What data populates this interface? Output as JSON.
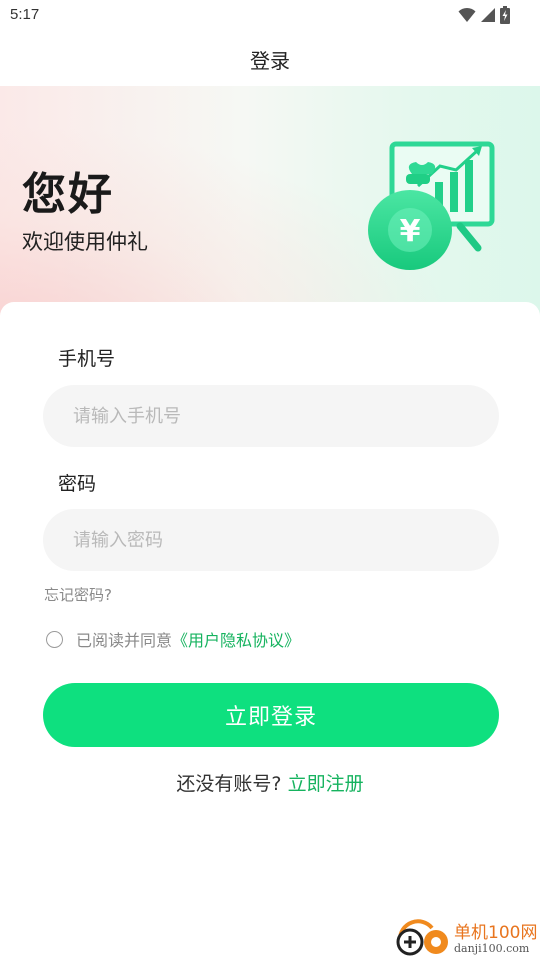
{
  "status_bar": {
    "time": "5:17"
  },
  "header": {
    "title": "登录"
  },
  "hero": {
    "greeting": "您好",
    "welcome": "欢迎使用仲礼",
    "illustration_icon": "money-bag-chart-icon",
    "accent_color": "#0ee07f"
  },
  "form": {
    "phone": {
      "label": "手机号",
      "placeholder": "请输入手机号",
      "value": ""
    },
    "password": {
      "label": "密码",
      "placeholder": "请输入密码",
      "value": ""
    },
    "forgot_label": "忘记密码?",
    "agreement": {
      "checked": false,
      "prefix": "已阅读并同意",
      "link": "《用户隐私协议》"
    },
    "login_label": "立即登录",
    "register_prompt": "还没有账号?",
    "register_link": "立即注册"
  },
  "watermark": {
    "name": "单机100网",
    "url": "danji100.com"
  },
  "colors": {
    "primary": "#0ee07f",
    "link": "#16b35f",
    "input_bg": "#f5f5f5"
  }
}
